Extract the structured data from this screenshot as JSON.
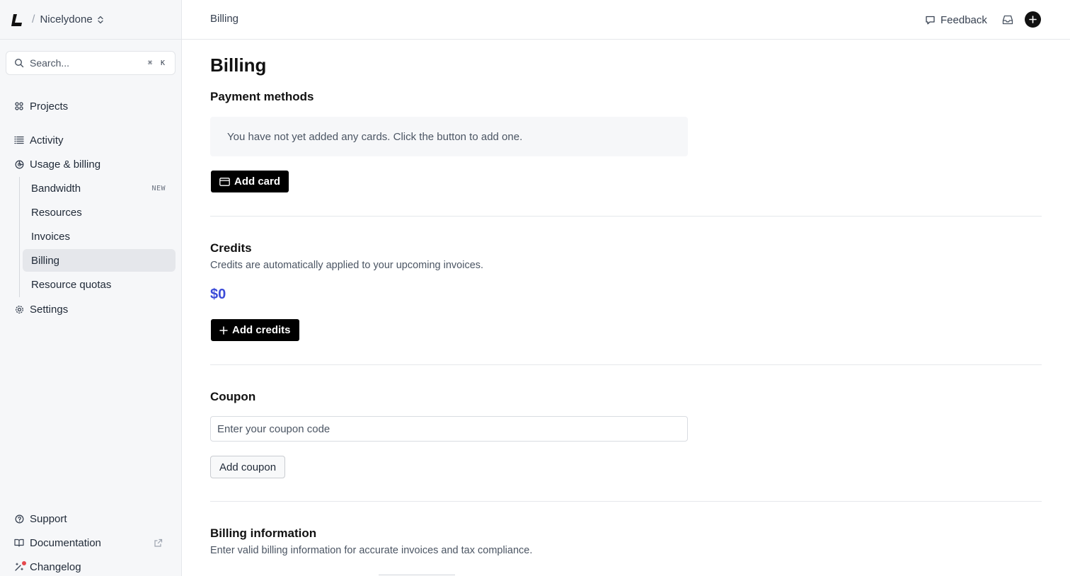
{
  "sidebar": {
    "team": {
      "name": "Nicelydone",
      "separator": "/"
    },
    "search": {
      "placeholder": "Search...",
      "shortcut_keys": [
        "⌘",
        "K"
      ]
    },
    "nav": {
      "projects": "Projects",
      "activity": "Activity",
      "usage_billing": "Usage & billing",
      "settings": "Settings"
    },
    "sub_items": [
      {
        "label": "Bandwidth",
        "badge": "NEW"
      },
      {
        "label": "Resources"
      },
      {
        "label": "Invoices"
      },
      {
        "label": "Billing",
        "active": true
      },
      {
        "label": "Resource quotas"
      }
    ],
    "footer": {
      "support": "Support",
      "documentation": "Documentation",
      "changelog": "Changelog"
    }
  },
  "topbar": {
    "breadcrumb": "Billing",
    "feedback_label": "Feedback"
  },
  "main": {
    "title": "Billing",
    "payment_methods": {
      "heading": "Payment methods",
      "empty_message": "You have not yet added any cards. Click the button to add one.",
      "add_card_label": "Add card"
    },
    "credits": {
      "heading": "Credits",
      "description": "Credits are automatically applied to your upcoming invoices.",
      "amount": "$0",
      "add_credits_label": "Add credits"
    },
    "coupon": {
      "heading": "Coupon",
      "placeholder": "Enter your coupon code",
      "value": "",
      "add_coupon_label": "Add coupon"
    },
    "billing_information": {
      "heading": "Billing information",
      "description": "Enter valid billing information for accurate invoices and tax compliance."
    }
  },
  "colors": {
    "sidebar_bg": "#f6f7f9",
    "active_item_bg": "#e5e7eb",
    "primary_button": "#000000",
    "credit_amount": "#3b4bd8",
    "notification_dot": "#e5484d"
  }
}
